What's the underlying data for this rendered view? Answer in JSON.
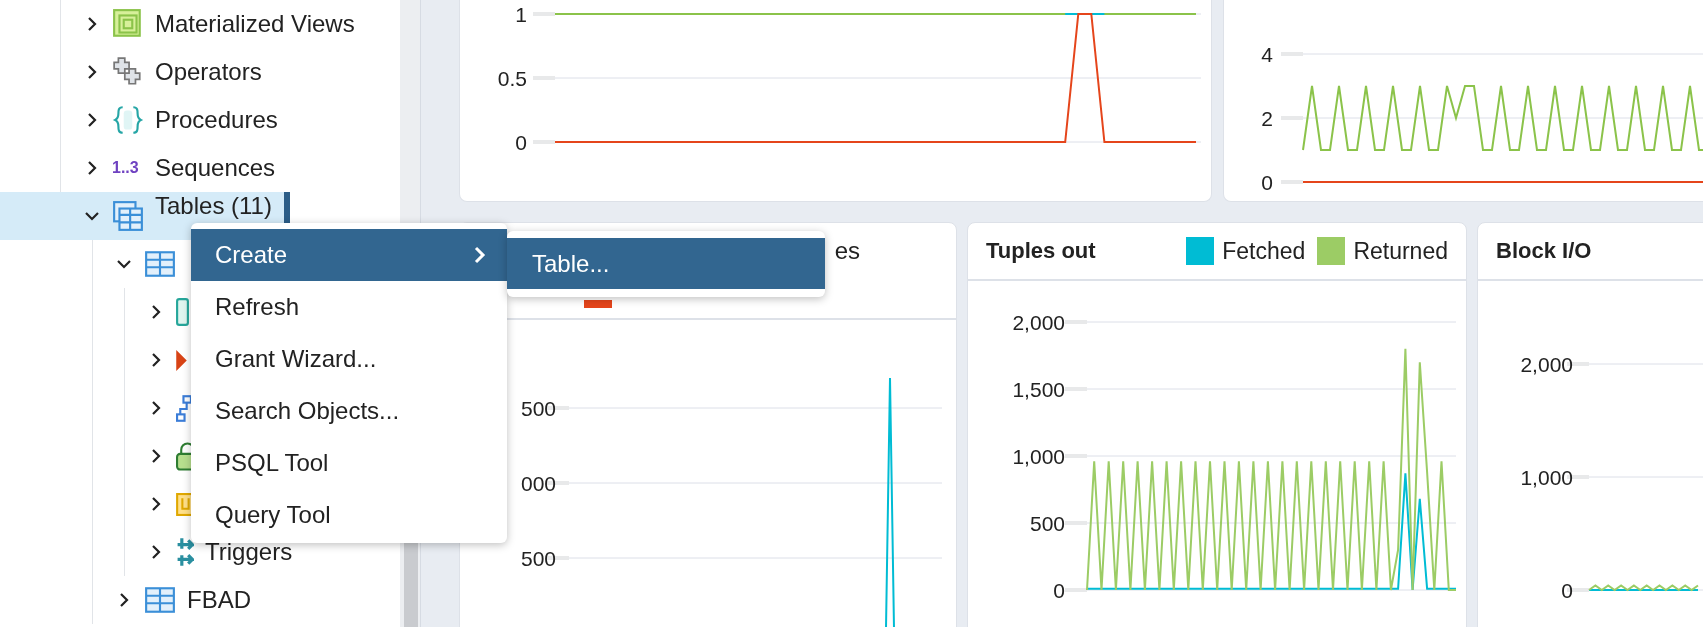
{
  "tree": {
    "items": [
      {
        "label": "Materialized Views",
        "kind": "matview",
        "expanded": false,
        "selected": false
      },
      {
        "label": "Operators",
        "kind": "operator",
        "expanded": false,
        "selected": false
      },
      {
        "label": "Procedures",
        "kind": "procedure",
        "expanded": false,
        "selected": false
      },
      {
        "label": "Sequences",
        "kind": "sequence",
        "badge": "1..3",
        "expanded": false,
        "selected": false
      },
      {
        "label": "Tables (11)",
        "kind": "tables",
        "expanded": true,
        "selected": true,
        "children": [
          {
            "kind": "table",
            "expanded": true,
            "selected": false,
            "children": [
              {
                "kind": "columns",
                "expanded": false,
                "selected": false
              },
              {
                "kind": "constraints",
                "expanded": false,
                "selected": false
              },
              {
                "kind": "indexes",
                "expanded": false,
                "selected": false
              },
              {
                "kind": "policies",
                "expanded": false,
                "selected": false
              },
              {
                "kind": "rules",
                "expanded": false,
                "selected": false
              },
              {
                "kind": "triggers",
                "label": "Triggers",
                "expanded": false,
                "selected": false
              }
            ]
          },
          {
            "label": "FBAD",
            "kind": "table",
            "expanded": false,
            "selected": false
          }
        ]
      }
    ]
  },
  "context_menu": {
    "items": [
      {
        "label": "Create",
        "selected": true,
        "has_submenu": true
      },
      {
        "label": "Refresh",
        "selected": false,
        "has_submenu": false
      },
      {
        "label": "Grant Wizard...",
        "selected": false,
        "has_submenu": false
      },
      {
        "label": "Search Objects...",
        "selected": false,
        "has_submenu": false
      },
      {
        "label": "PSQL Tool",
        "selected": false,
        "has_submenu": false
      },
      {
        "label": "Query Tool",
        "selected": false,
        "has_submenu": false
      }
    ],
    "submenu": {
      "items": [
        {
          "label": "Table...",
          "selected": true
        }
      ]
    }
  },
  "dashboard": {
    "top": [
      {
        "chart_data": {
          "type": "line",
          "ylim": [
            0,
            1
          ],
          "grid": true,
          "yticks": [
            0,
            0.5,
            1
          ],
          "series": [
            {
              "color": "#8bc34a",
              "values": [
                1,
                1,
                1,
                1,
                1,
                1,
                1,
                1,
                1,
                1,
                1,
                1,
                1,
                1,
                1,
                1,
                1,
                1,
                1,
                1,
                1,
                1,
                1,
                1,
                1,
                1,
                1,
                1,
                1,
                1,
                1,
                1,
                1,
                1,
                1,
                1,
                1,
                1,
                1,
                1,
                1,
                1,
                1,
                1,
                1,
                1,
                1,
                1,
                1,
                1
              ]
            },
            {
              "color": "#00bcd4",
              "values": [
                null,
                null,
                null,
                null,
                null,
                null,
                null,
                null,
                null,
                null,
                null,
                null,
                null,
                null,
                null,
                null,
                null,
                null,
                null,
                null,
                null,
                null,
                null,
                null,
                null,
                null,
                null,
                null,
                null,
                null,
                null,
                null,
                null,
                null,
                null,
                null,
                null,
                null,
                null,
                1,
                1,
                1,
                1,
                null,
                null,
                null,
                null,
                null,
                null,
                null
              ]
            },
            {
              "color": "#e5451b",
              "values": [
                0,
                0,
                0,
                0,
                0,
                0,
                0,
                0,
                0,
                0,
                0,
                0,
                0,
                0,
                0,
                0,
                0,
                0,
                0,
                0,
                0,
                0,
                0,
                0,
                0,
                0,
                0,
                0,
                0,
                0,
                0,
                0,
                0,
                0,
                0,
                0,
                0,
                0,
                0,
                0,
                1,
                1,
                0,
                0,
                0,
                0,
                0,
                0,
                0,
                0
              ]
            }
          ]
        }
      },
      {
        "chart_data": {
          "type": "line",
          "ylim": [
            0,
            4
          ],
          "grid": true,
          "yticks": [
            0,
            2,
            4
          ],
          "series": [
            {
              "color": "#8bc34a",
              "values": [
                1,
                3,
                1,
                1,
                3,
                1,
                1,
                3,
                1,
                1,
                3,
                1,
                1,
                3,
                1,
                1,
                3,
                2,
                3,
                3,
                1,
                1,
                3,
                1,
                1,
                3,
                1,
                1,
                3,
                1,
                1,
                3,
                1,
                1,
                3,
                1,
                1,
                3,
                1,
                1,
                3,
                1,
                1,
                3,
                1,
                1
              ]
            },
            {
              "color": "#e5451b",
              "values": [
                0,
                0,
                0,
                0,
                0,
                0,
                0,
                0,
                0,
                0,
                0,
                0,
                0,
                0,
                0,
                0,
                0,
                0,
                0,
                0,
                0,
                0,
                0,
                0,
                0,
                0,
                0,
                0,
                0,
                0,
                0,
                0,
                0,
                0,
                0,
                0,
                0,
                0,
                0,
                0,
                0,
                0,
                0,
                0,
                0,
                0
              ]
            }
          ]
        }
      }
    ],
    "bottom": [
      {
        "kind": "partial",
        "title": "es",
        "legend": [
          {
            "color": "#e5451b"
          }
        ],
        "axis_labels": [
          "500",
          "000",
          "500"
        ]
      },
      {
        "kind": "chart",
        "title": "Tuples out",
        "chart_data": {
          "type": "line",
          "ylim": [
            0,
            2000
          ],
          "grid": true,
          "yticks": [
            {
              "value": 0,
              "label": "0"
            },
            {
              "value": 500,
              "label": "500"
            },
            {
              "value": 1000,
              "label": "1,000"
            },
            {
              "value": 1500,
              "label": "1,500"
            },
            {
              "value": 2000,
              "label": "2,000"
            }
          ],
          "series": [
            {
              "name": "Fetched",
              "color": "#00bcd4",
              "values": [
                10,
                10,
                10,
                10,
                10,
                10,
                10,
                10,
                10,
                10,
                10,
                10,
                10,
                10,
                10,
                10,
                10,
                10,
                10,
                10,
                10,
                10,
                10,
                10,
                10,
                10,
                10,
                10,
                10,
                10,
                10,
                10,
                10,
                10,
                10,
                10,
                10,
                10,
                10,
                10,
                10,
                10,
                10,
                10,
                870,
                0,
                680,
                10,
                10,
                10,
                10,
                10
              ]
            },
            {
              "name": "Returned",
              "color": "#9ccc65",
              "values": [
                0,
                960,
                0,
                960,
                0,
                960,
                0,
                960,
                0,
                960,
                0,
                960,
                0,
                960,
                0,
                960,
                0,
                960,
                0,
                960,
                0,
                960,
                0,
                960,
                0,
                960,
                0,
                960,
                0,
                960,
                0,
                960,
                0,
                960,
                0,
                960,
                0,
                960,
                0,
                960,
                0,
                960,
                0,
                300,
                1800,
                0,
                1700,
                880,
                0,
                960,
                0,
                0
              ]
            }
          ]
        }
      },
      {
        "kind": "chart",
        "title": "Block I/O",
        "chart_data": {
          "type": "line",
          "ylim": [
            0,
            2000
          ],
          "grid": true,
          "yticks": [
            {
              "value": 0,
              "label": "0"
            },
            {
              "value": 1000,
              "label": "1,000"
            },
            {
              "value": 2000,
              "label": "2,000"
            }
          ],
          "series": [
            {
              "color": "#00bcd4",
              "values": [
                0,
                0,
                0,
                0,
                0,
                0,
                0,
                0,
                0,
                0,
                0,
                0,
                0,
                0,
                0,
                0,
                0,
                0
              ]
            },
            {
              "color": "#9ccc65",
              "values": [
                0,
                40,
                0,
                40,
                0,
                40,
                0,
                40,
                0,
                40,
                0,
                40,
                0,
                40,
                0,
                40,
                0,
                40
              ]
            }
          ]
        }
      }
    ]
  }
}
